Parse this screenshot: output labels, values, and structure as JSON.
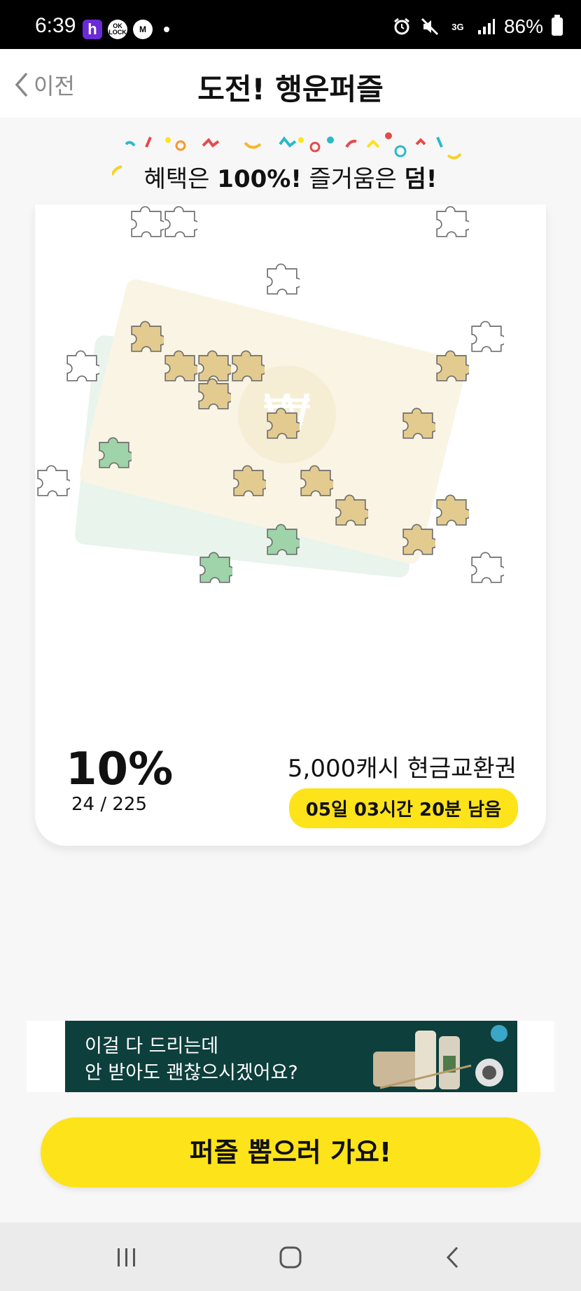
{
  "status_bar": {
    "time": "6:39",
    "apps": [
      {
        "icon": "h-app-icon",
        "label": "h"
      },
      {
        "icon": "oklock-icon",
        "label": "OK LOCK"
      },
      {
        "icon": "m-app-icon",
        "label": "M"
      }
    ],
    "network": "3G",
    "battery": "86%",
    "icons": [
      "alarm-icon",
      "mute-icon",
      "network-3g-icon",
      "signal-icon",
      "battery-icon"
    ]
  },
  "header": {
    "back_label": "이전",
    "title": "도전! 행운퍼즐"
  },
  "promo": {
    "prefix": "혜택은 ",
    "bold1": "100%!",
    "middle": " 즐거움은 ",
    "bold2": "덤!"
  },
  "card": {
    "progress_percent": "10%",
    "progress_count": "24 / 225",
    "progress_fraction": 0.1067,
    "prize": "5,000캐시 현금교환권",
    "time_remaining": "05일 03시간 20분 남음"
  },
  "ad": {
    "line1": "이걸 다 드리는데",
    "line2": "안 받아도 괜찮으시겠어요?"
  },
  "cta": {
    "label": "퍼즐 뽑으러 가요!"
  },
  "colors": {
    "accent_yellow": "#fde31a",
    "ad_background": "#0d3f3c",
    "card_background": "#ffffff",
    "page_background": "#f7f7f7"
  }
}
